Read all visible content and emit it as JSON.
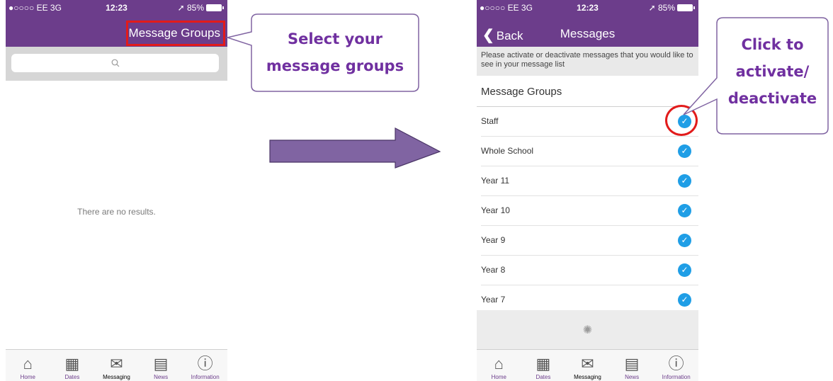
{
  "left_screen": {
    "status": {
      "carrier": "●○○○○ EE  3G",
      "time": "12:23",
      "battery": "➚ 85%"
    },
    "title": "Message Groups",
    "search_icon": "search-icon",
    "empty_text": "There are no results."
  },
  "right_screen": {
    "status": {
      "carrier": "●○○○○ EE  3G",
      "time": "12:23",
      "battery": "➚ 85%"
    },
    "back_label": "Back",
    "title": "Messages",
    "info_text": "Please activate or deactivate messages that you would like to see in your message list",
    "section_heading": "Message Groups",
    "groups": [
      {
        "label": "Staff",
        "checked": true
      },
      {
        "label": "Whole School",
        "checked": true
      },
      {
        "label": "Year 11",
        "checked": true
      },
      {
        "label": "Year 10",
        "checked": true
      },
      {
        "label": "Year 9",
        "checked": true
      },
      {
        "label": "Year 8",
        "checked": true
      },
      {
        "label": "Year 7",
        "checked": true
      }
    ]
  },
  "tabbar": [
    {
      "label": "Home",
      "icon": "home-icon"
    },
    {
      "label": "Dates",
      "icon": "calendar-icon"
    },
    {
      "label": "Messaging",
      "icon": "envelope-icon"
    },
    {
      "label": "News",
      "icon": "newspaper-icon"
    },
    {
      "label": "Information",
      "icon": "info-icon"
    }
  ],
  "callouts": {
    "select_groups": [
      "Select your",
      "message groups"
    ],
    "activate": [
      "Click to",
      "activate/",
      "deactivate"
    ]
  },
  "colors": {
    "header_purple": "#6c3d8b",
    "callout_text": "#7030a0",
    "highlight_red": "#e21b1b",
    "check_blue": "#1f9ee6",
    "arrow_fill": "#8064a2"
  }
}
